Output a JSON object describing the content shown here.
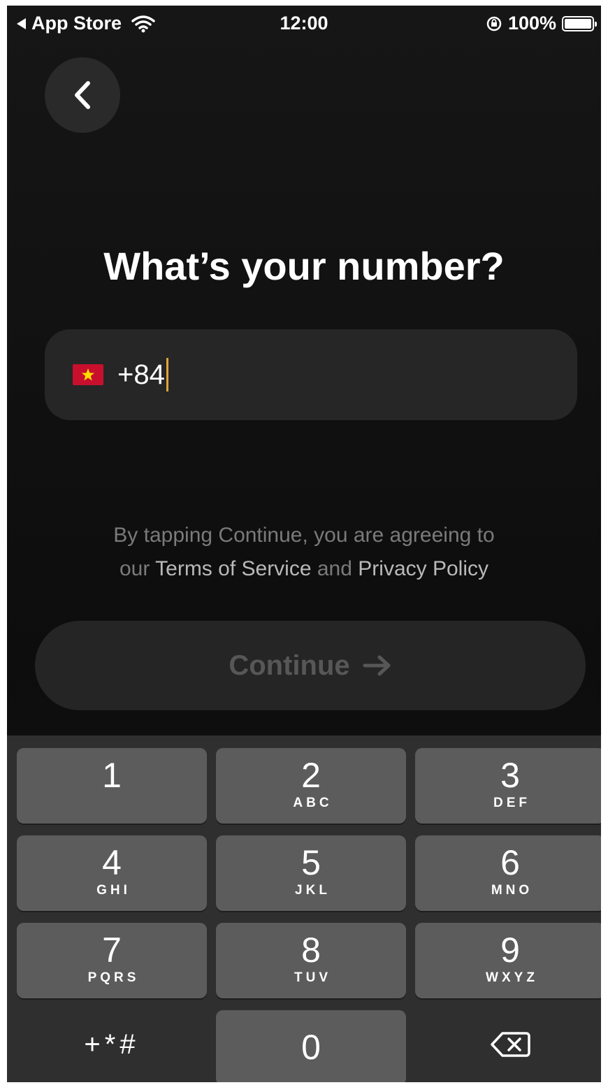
{
  "status_bar": {
    "back_app": "App Store",
    "time": "12:00",
    "battery": "100%"
  },
  "screen": {
    "title": "What’s your number?",
    "phone_input": {
      "country": "Vietnam",
      "value": "+84"
    },
    "agreement": {
      "line1": "By tapping Continue, you are agreeing to",
      "prefix": "our",
      "terms_link": "Terms of Service",
      "conjunction": "and",
      "privacy_link": "Privacy Policy"
    },
    "continue_label": "Continue"
  },
  "keypad": {
    "keys": [
      {
        "digit": "1",
        "letters": ""
      },
      {
        "digit": "2",
        "letters": "ABC"
      },
      {
        "digit": "3",
        "letters": "DEF"
      },
      {
        "digit": "4",
        "letters": "GHI"
      },
      {
        "digit": "5",
        "letters": "JKL"
      },
      {
        "digit": "6",
        "letters": "MNO"
      },
      {
        "digit": "7",
        "letters": "PQRS"
      },
      {
        "digit": "8",
        "letters": "TUV"
      },
      {
        "digit": "9",
        "letters": "WXYZ"
      },
      {
        "digit": "0",
        "letters": ""
      }
    ],
    "symbols_label": "+*#"
  },
  "colors": {
    "background": "#111111",
    "field": "#262626",
    "key": "#5c5c5c",
    "caret": "#e0a53a"
  }
}
